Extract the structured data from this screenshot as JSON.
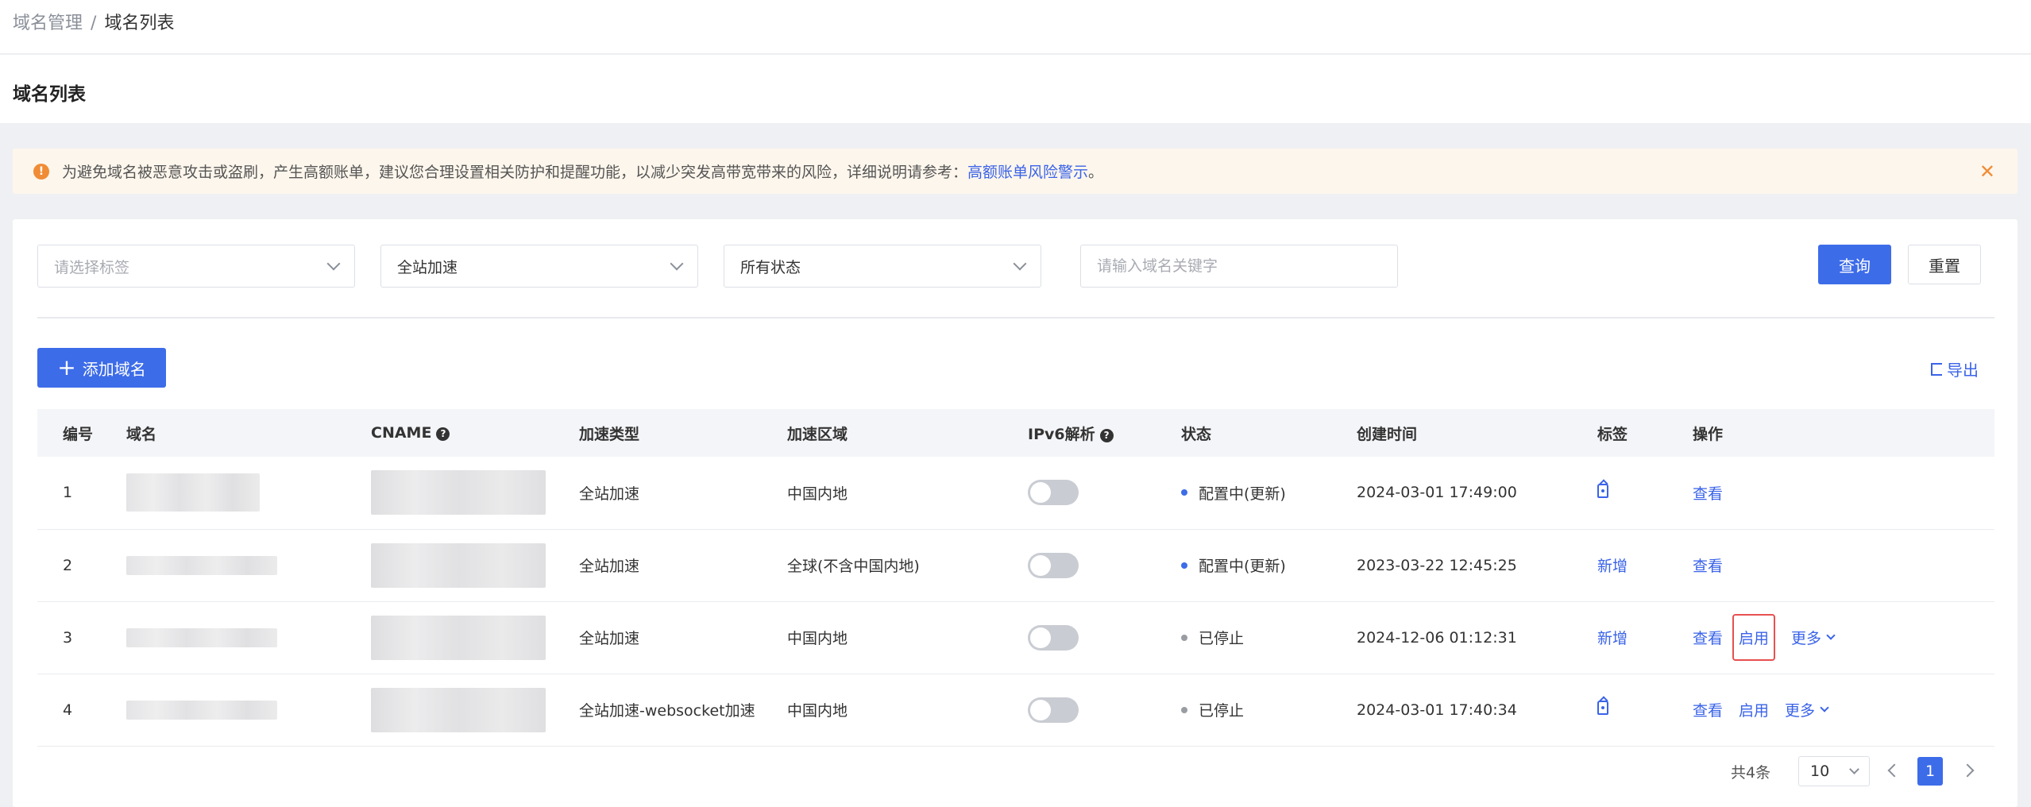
{
  "breadcrumb": {
    "parent": "域名管理",
    "separator": "/",
    "current": "域名列表"
  },
  "page_title": "域名列表",
  "alert": {
    "text": "为避免域名被恶意攻击或盗刷，产生高额账单，建议您合理设置相关防护和提醒功能，以减少突发高带宽带来的风险，详细说明请参考：",
    "link_text": "高额账单风险警示",
    "suffix": "。",
    "icon_glyph": "!",
    "close_glyph": "✕"
  },
  "filters": {
    "tag_placeholder": "请选择标签",
    "type_value": "全站加速",
    "status_value": "所有状态",
    "keyword_placeholder": "请输入域名关键字",
    "query_label": "查询",
    "reset_label": "重置"
  },
  "toolbar": {
    "add_label": "添加域名",
    "add_glyph": "+",
    "export_label": "导出"
  },
  "table": {
    "columns": [
      "编号",
      "域名",
      "CNAME",
      "加速类型",
      "加速区域",
      "IPv6解析",
      "状态",
      "创建时间",
      "标签",
      "操作"
    ],
    "help_glyph": "?",
    "rows": [
      {
        "id": "1",
        "type": "全站加速",
        "region": "中国内地",
        "status": "配置中(更新)",
        "status_color": "#3d6ce9",
        "created": "2024-03-01 17:49:00",
        "tag": "",
        "ops": [
          "查看"
        ]
      },
      {
        "id": "2",
        "type": "全站加速",
        "region": "全球(不含中国内地)",
        "status": "配置中(更新)",
        "status_color": "#3d6ce9",
        "created": "2023-03-22 12:45:25",
        "tag": "新增",
        "ops": [
          "查看"
        ]
      },
      {
        "id": "3",
        "type": "全站加速",
        "region": "中国内地",
        "status": "已停止",
        "status_color": "#9a9ca3",
        "created": "2024-12-06 01:12:31",
        "tag": "新增",
        "ops": [
          "查看",
          "启用",
          "更多"
        ]
      },
      {
        "id": "4",
        "type": "全站加速-websocket加速",
        "region": "中国内地",
        "status": "已停止",
        "status_color": "#9a9ca3",
        "created": "2024-03-01 17:40:34",
        "tag": "",
        "ops": [
          "查看",
          "启用",
          "更多"
        ]
      }
    ]
  },
  "pagination": {
    "total": "共4条",
    "page_size": "10",
    "current_page": "1"
  },
  "colors": {
    "primary": "#3d6ce9",
    "warning": "#f08c36",
    "highlight": "#e85050"
  }
}
